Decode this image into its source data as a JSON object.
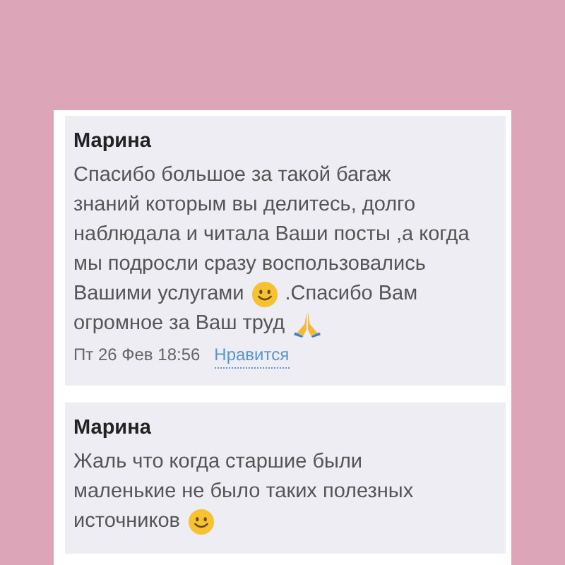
{
  "comments": [
    {
      "author": "Марина",
      "lines": [
        [
          {
            "kind": "text",
            "text": "Спасибо большое за такой багаж"
          }
        ],
        [
          {
            "kind": "text",
            "text": "знаний которым вы делитесь, долго"
          }
        ],
        [
          {
            "kind": "text",
            "text": "наблюдала и читала Ваши посты ,а когда"
          }
        ],
        [
          {
            "kind": "text",
            "text": "мы подросли сразу воспользовались"
          }
        ],
        [
          {
            "kind": "text",
            "text": "Вашими услугами"
          },
          {
            "kind": "smile"
          },
          {
            "kind": "text",
            "text": ".Спасибо Вам"
          }
        ],
        [
          {
            "kind": "text",
            "text": "огромное за Ваш труд"
          },
          {
            "kind": "pray"
          }
        ]
      ],
      "date": "Пт 26 Фев 18:56",
      "like": "Нравится"
    },
    {
      "author": "Марина",
      "lines": [
        [
          {
            "kind": "text",
            "text": "Жаль что когда старшие были"
          }
        ],
        [
          {
            "kind": "text",
            "text": "маленькие не было таких полезных"
          }
        ],
        [
          {
            "kind": "text",
            "text": "источников"
          },
          {
            "kind": "smile"
          }
        ]
      ]
    }
  ]
}
